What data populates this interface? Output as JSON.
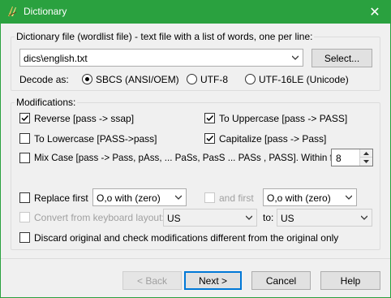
{
  "window": {
    "title": "Dictionary",
    "close_glyph": "✕",
    "app_icon": "green-leaf-icon"
  },
  "file_group": {
    "label": "Dictionary file (wordlist file) - text file with a list of words, one per line:",
    "path": "dics\\english.txt",
    "select_label": "Select...",
    "decode_label": "Decode as:",
    "encodings": [
      {
        "label": "SBCS (ANSI/OEM)",
        "selected": true
      },
      {
        "label": "UTF-8",
        "selected": false
      },
      {
        "label": "UTF-16LE (Unicode)",
        "selected": false
      }
    ]
  },
  "modifications": {
    "label": "Modifications:",
    "reverse": {
      "label": "Reverse [pass -> ssap]",
      "checked": true
    },
    "uppercase": {
      "label": "To Uppercase [pass -> PASS]",
      "checked": true
    },
    "lowercase": {
      "label": "To Lowercase [PASS->pass]",
      "checked": false
    },
    "capitalize": {
      "label": "Capitalize [pass -> Pass]",
      "checked": true
    },
    "mixcase": {
      "label": "Mix Case [pass -> Pass, pAss, ... PaSs, PasS ... PASs , PASS]. Within first:",
      "checked": false,
      "within_first": "8"
    },
    "replace_first": {
      "label": "Replace first",
      "checked": false,
      "value": "O,o with (zero)"
    },
    "and_first": {
      "label": "and first",
      "checked": false,
      "value": "O,o with (zero)"
    },
    "keyboard": {
      "label": "Convert from keyboard layout:",
      "checked": false,
      "from": "US",
      "to_label": "to:",
      "to": "US"
    },
    "discard": {
      "label": "Discard original and check modifications different from the original only",
      "checked": false
    }
  },
  "buttons": {
    "back": "< Back",
    "next": "Next >",
    "cancel": "Cancel",
    "help": "Help"
  }
}
